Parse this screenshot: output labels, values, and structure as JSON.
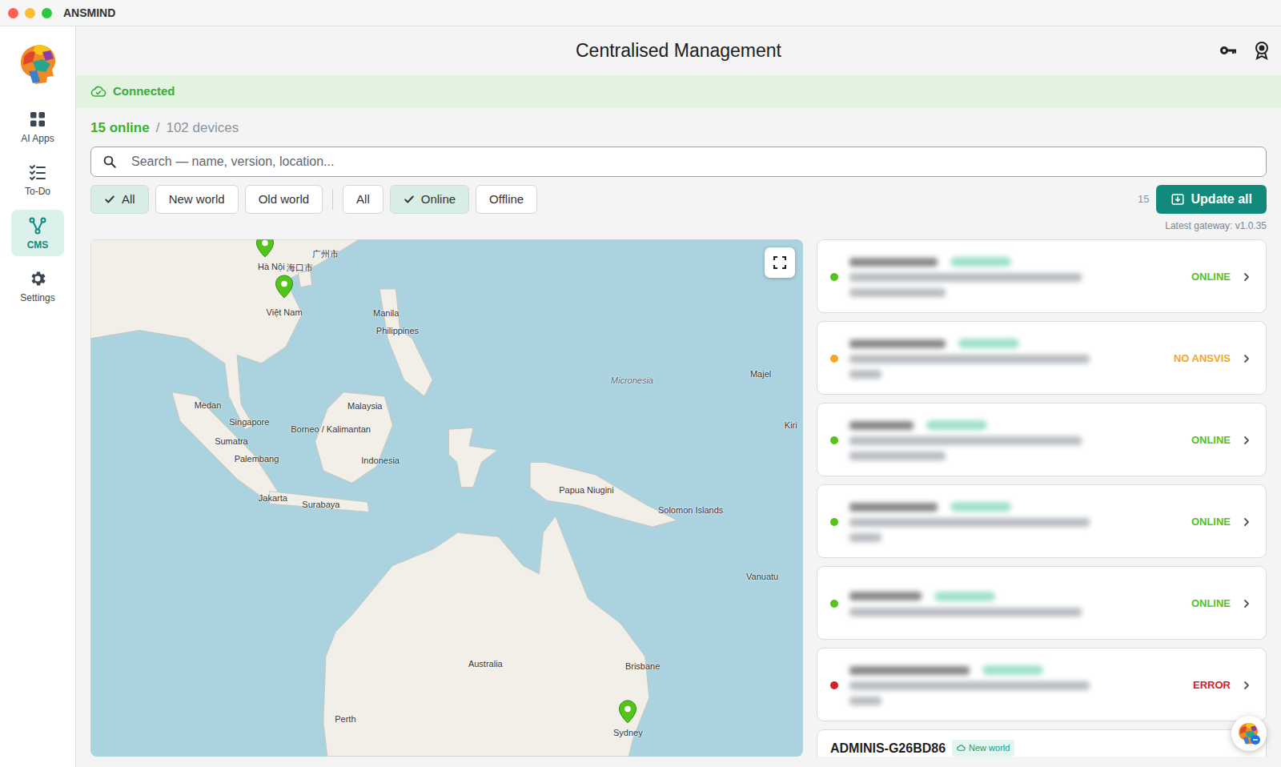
{
  "window": {
    "title": "ANSMIND"
  },
  "sidebar": {
    "items": [
      {
        "label": "AI Apps",
        "selected": false
      },
      {
        "label": "To-Do",
        "selected": false
      },
      {
        "label": "CMS",
        "selected": true
      },
      {
        "label": "Settings",
        "selected": false
      }
    ]
  },
  "header": {
    "title": "Centralised Management"
  },
  "connection": {
    "label": "Connected"
  },
  "summary": {
    "online": "15 online",
    "separator": "/",
    "total": "102 devices"
  },
  "search": {
    "placeholder": "Search — name, version, location..."
  },
  "filters": {
    "world": [
      {
        "label": "All",
        "selected": true
      },
      {
        "label": "New world",
        "selected": false
      },
      {
        "label": "Old world",
        "selected": false
      }
    ],
    "status": [
      {
        "label": "All",
        "selected": false
      },
      {
        "label": "Online",
        "selected": true
      },
      {
        "label": "Offline",
        "selected": false
      }
    ]
  },
  "update": {
    "count": "15",
    "button": "Update all",
    "latest": "Latest gateway: v1.0.35"
  },
  "map": {
    "labels": [
      "Hà Nội",
      "Việt Nam",
      "广州市",
      "海口市",
      "Manila",
      "Philippines",
      "Micronesia",
      "Majel",
      "Kiri",
      "Medan",
      "Malaysia",
      "Singapore",
      "Borneo / Kalimantan",
      "Sumatra",
      "Palembang",
      "Indonesia",
      "Jakarta",
      "Surabaya",
      "Papua Niugini",
      "Solomon Islands",
      "Vanuatu",
      "Australia",
      "Brisbane",
      "Perth",
      "Sydney"
    ],
    "pins": [
      {
        "color": "#52c41a"
      },
      {
        "color": "#52c41a"
      },
      {
        "color": "#52c41a"
      }
    ]
  },
  "devices": [
    {
      "redacted": true,
      "status": "ONLINE",
      "color": "#52c41a"
    },
    {
      "redacted": true,
      "status": "NO ANSVIS",
      "color": "#f5a623"
    },
    {
      "redacted": true,
      "status": "ONLINE",
      "color": "#52c41a"
    },
    {
      "redacted": true,
      "status": "ONLINE",
      "color": "#52c41a"
    },
    {
      "redacted": true,
      "status": "ONLINE",
      "color": "#52c41a"
    },
    {
      "redacted": true,
      "status": "ERROR",
      "color": "#d4202c"
    },
    {
      "redacted": false,
      "name": "ADMINIS-G26BD86",
      "tag": "New world"
    }
  ]
}
